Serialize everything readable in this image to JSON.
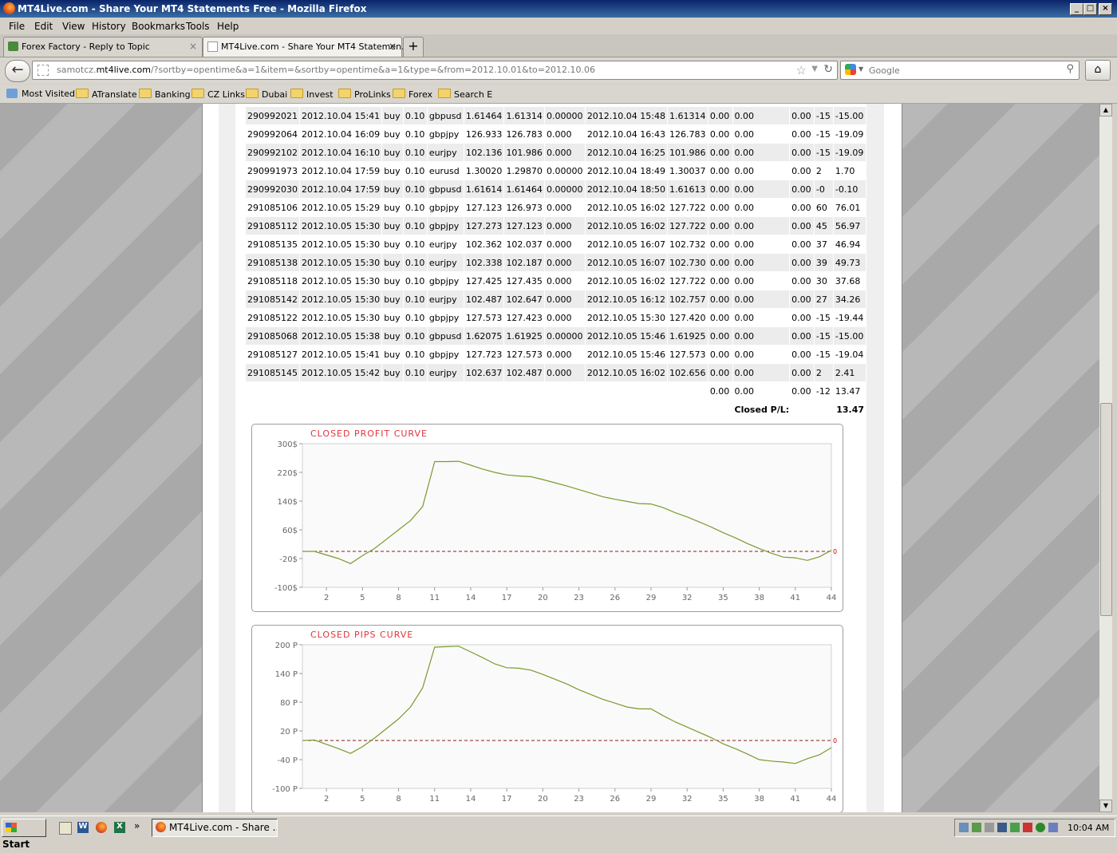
{
  "window": {
    "title": "MT4Live.com - Share Your MT4 Statements Free - Mozilla Firefox"
  },
  "menu": [
    "File",
    "Edit",
    "View",
    "History",
    "Bookmarks",
    "Tools",
    "Help"
  ],
  "tabs": [
    {
      "label": "Forex Factory - Reply to Topic"
    },
    {
      "label": "MT4Live.com - Share Your MT4 Statemen..."
    }
  ],
  "nav": {
    "url_prefix": "samotcz.",
    "url_host": "mt4live.com",
    "url_path": "/?sortby=opentime&a=1&item=&sortby=opentime&a=1&type=&from=2012.10.01&to=2012.10.06",
    "search_placeholder": "Google"
  },
  "bookmarks": [
    "Most Visited",
    "ATranslate",
    "Banking",
    "CZ Links",
    "Dubai",
    "Invest",
    "ProLinks",
    "Forex",
    "Search E"
  ],
  "trades": [
    [
      "290992021",
      "2012.10.04 15:41",
      "buy",
      "0.10",
      "gbpusd",
      "1.61464",
      "1.61314",
      "0.00000",
      "2012.10.04 15:48",
      "1.61314",
      "0.00",
      "0.00",
      "0.00",
      "-15",
      "-15.00"
    ],
    [
      "290992064",
      "2012.10.04 16:09",
      "buy",
      "0.10",
      "gbpjpy",
      "126.933",
      "126.783",
      "0.000",
      "2012.10.04 16:43",
      "126.783",
      "0.00",
      "0.00",
      "0.00",
      "-15",
      "-19.09"
    ],
    [
      "290992102",
      "2012.10.04 16:10",
      "buy",
      "0.10",
      "eurjpy",
      "102.136",
      "101.986",
      "0.000",
      "2012.10.04 16:25",
      "101.986",
      "0.00",
      "0.00",
      "0.00",
      "-15",
      "-19.09"
    ],
    [
      "290991973",
      "2012.10.04 17:59",
      "buy",
      "0.10",
      "eurusd",
      "1.30020",
      "1.29870",
      "0.00000",
      "2012.10.04 18:49",
      "1.30037",
      "0.00",
      "0.00",
      "0.00",
      "2",
      "1.70"
    ],
    [
      "290992030",
      "2012.10.04 17:59",
      "buy",
      "0.10",
      "gbpusd",
      "1.61614",
      "1.61464",
      "0.00000",
      "2012.10.04 18:50",
      "1.61613",
      "0.00",
      "0.00",
      "0.00",
      "-0",
      "-0.10"
    ],
    [
      "291085106",
      "2012.10.05 15:29",
      "buy",
      "0.10",
      "gbpjpy",
      "127.123",
      "126.973",
      "0.000",
      "2012.10.05 16:02",
      "127.722",
      "0.00",
      "0.00",
      "0.00",
      "60",
      "76.01"
    ],
    [
      "291085112",
      "2012.10.05 15:30",
      "buy",
      "0.10",
      "gbpjpy",
      "127.273",
      "127.123",
      "0.000",
      "2012.10.05 16:02",
      "127.722",
      "0.00",
      "0.00",
      "0.00",
      "45",
      "56.97"
    ],
    [
      "291085135",
      "2012.10.05 15:30",
      "buy",
      "0.10",
      "eurjpy",
      "102.362",
      "102.037",
      "0.000",
      "2012.10.05 16:07",
      "102.732",
      "0.00",
      "0.00",
      "0.00",
      "37",
      "46.94"
    ],
    [
      "291085138",
      "2012.10.05 15:30",
      "buy",
      "0.10",
      "eurjpy",
      "102.338",
      "102.187",
      "0.000",
      "2012.10.05 16:07",
      "102.730",
      "0.00",
      "0.00",
      "0.00",
      "39",
      "49.73"
    ],
    [
      "291085118",
      "2012.10.05 15:30",
      "buy",
      "0.10",
      "gbpjpy",
      "127.425",
      "127.435",
      "0.000",
      "2012.10.05 16:02",
      "127.722",
      "0.00",
      "0.00",
      "0.00",
      "30",
      "37.68"
    ],
    [
      "291085142",
      "2012.10.05 15:30",
      "buy",
      "0.10",
      "eurjpy",
      "102.487",
      "102.647",
      "0.000",
      "2012.10.05 16:12",
      "102.757",
      "0.00",
      "0.00",
      "0.00",
      "27",
      "34.26"
    ],
    [
      "291085122",
      "2012.10.05 15:30",
      "buy",
      "0.10",
      "gbpjpy",
      "127.573",
      "127.423",
      "0.000",
      "2012.10.05 15:30",
      "127.420",
      "0.00",
      "0.00",
      "0.00",
      "-15",
      "-19.44"
    ],
    [
      "291085068",
      "2012.10.05 15:38",
      "buy",
      "0.10",
      "gbpusd",
      "1.62075",
      "1.61925",
      "0.00000",
      "2012.10.05 15:46",
      "1.61925",
      "0.00",
      "0.00",
      "0.00",
      "-15",
      "-15.00"
    ],
    [
      "291085127",
      "2012.10.05 15:41",
      "buy",
      "0.10",
      "gbpjpy",
      "127.723",
      "127.573",
      "0.000",
      "2012.10.05 15:46",
      "127.573",
      "0.00",
      "0.00",
      "0.00",
      "-15",
      "-19.04"
    ],
    [
      "291085145",
      "2012.10.05 15:42",
      "buy",
      "0.10",
      "eurjpy",
      "102.637",
      "102.487",
      "0.000",
      "2012.10.05 16:02",
      "102.656",
      "0.00",
      "0.00",
      "0.00",
      "2",
      "2.41"
    ]
  ],
  "totals": [
    "0.00",
    "0.00",
    "0.00",
    "-12",
    "13.47"
  ],
  "closed_pl": {
    "label": "Closed P/L:",
    "value": "13.47"
  },
  "chart_data": [
    {
      "type": "line",
      "title": "CLOSED PROFIT CURVE",
      "color": "#7a9a2e",
      "zero_line_color": "#8b1a1a",
      "zero_label": "0",
      "ylim": [
        -100,
        300
      ],
      "yticks": [
        "300$",
        "220$",
        "140$",
        "60$",
        "-20$",
        "-100$"
      ],
      "xticks": [
        "2",
        "5",
        "8",
        "11",
        "14",
        "17",
        "20",
        "23",
        "26",
        "29",
        "32",
        "35",
        "38",
        "41",
        "44"
      ],
      "x": [
        0,
        1,
        2,
        3,
        4,
        5,
        6,
        7,
        8,
        9,
        10,
        11,
        12,
        13,
        14,
        15,
        16,
        17,
        18,
        19,
        20,
        21,
        22,
        23,
        24,
        25,
        26,
        27,
        28,
        29,
        30,
        31,
        32,
        33,
        34,
        35,
        36,
        37,
        38,
        39,
        40,
        41,
        42,
        43,
        44
      ],
      "values": [
        0,
        0,
        -10,
        -20,
        -34,
        -12,
        8,
        34,
        60,
        86,
        125,
        250,
        250,
        251,
        240,
        229,
        220,
        213,
        210,
        208,
        200,
        191,
        182,
        172,
        162,
        152,
        145,
        139,
        133,
        132,
        122,
        108,
        96,
        82,
        68,
        52,
        38,
        22,
        8,
        -5,
        -16,
        -18,
        -25,
        -15,
        3
      ]
    },
    {
      "type": "line",
      "title": "CLOSED PIPS CURVE",
      "color": "#7a9a2e",
      "zero_line_color": "#8b1a1a",
      "zero_label": "0",
      "ylim": [
        -100,
        200
      ],
      "yticks": [
        "200 P",
        "140 P",
        "80 P",
        "20 P",
        "-40 P",
        "-100 P"
      ],
      "xticks": [
        "2",
        "5",
        "8",
        "11",
        "14",
        "17",
        "20",
        "23",
        "26",
        "29",
        "32",
        "35",
        "38",
        "41",
        "44"
      ],
      "x": [
        0,
        1,
        2,
        3,
        4,
        5,
        6,
        7,
        8,
        9,
        10,
        11,
        12,
        13,
        14,
        15,
        16,
        17,
        18,
        19,
        20,
        21,
        22,
        23,
        24,
        25,
        26,
        27,
        28,
        29,
        30,
        31,
        32,
        33,
        34,
        35,
        36,
        37,
        38,
        39,
        40,
        41,
        42,
        43,
        44
      ],
      "values": [
        0,
        1,
        -8,
        -17,
        -27,
        -13,
        5,
        25,
        45,
        70,
        110,
        195,
        196,
        197,
        185,
        173,
        160,
        152,
        151,
        147,
        138,
        128,
        118,
        106,
        96,
        86,
        78,
        70,
        66,
        66,
        52,
        39,
        28,
        17,
        6,
        -7,
        -17,
        -28,
        -40,
        -43,
        -45,
        -48,
        -38,
        -30,
        -15
      ]
    }
  ],
  "taskbar": {
    "start": "Start",
    "task": "MT4Live.com - Share ...",
    "clock": "10:04 AM"
  }
}
